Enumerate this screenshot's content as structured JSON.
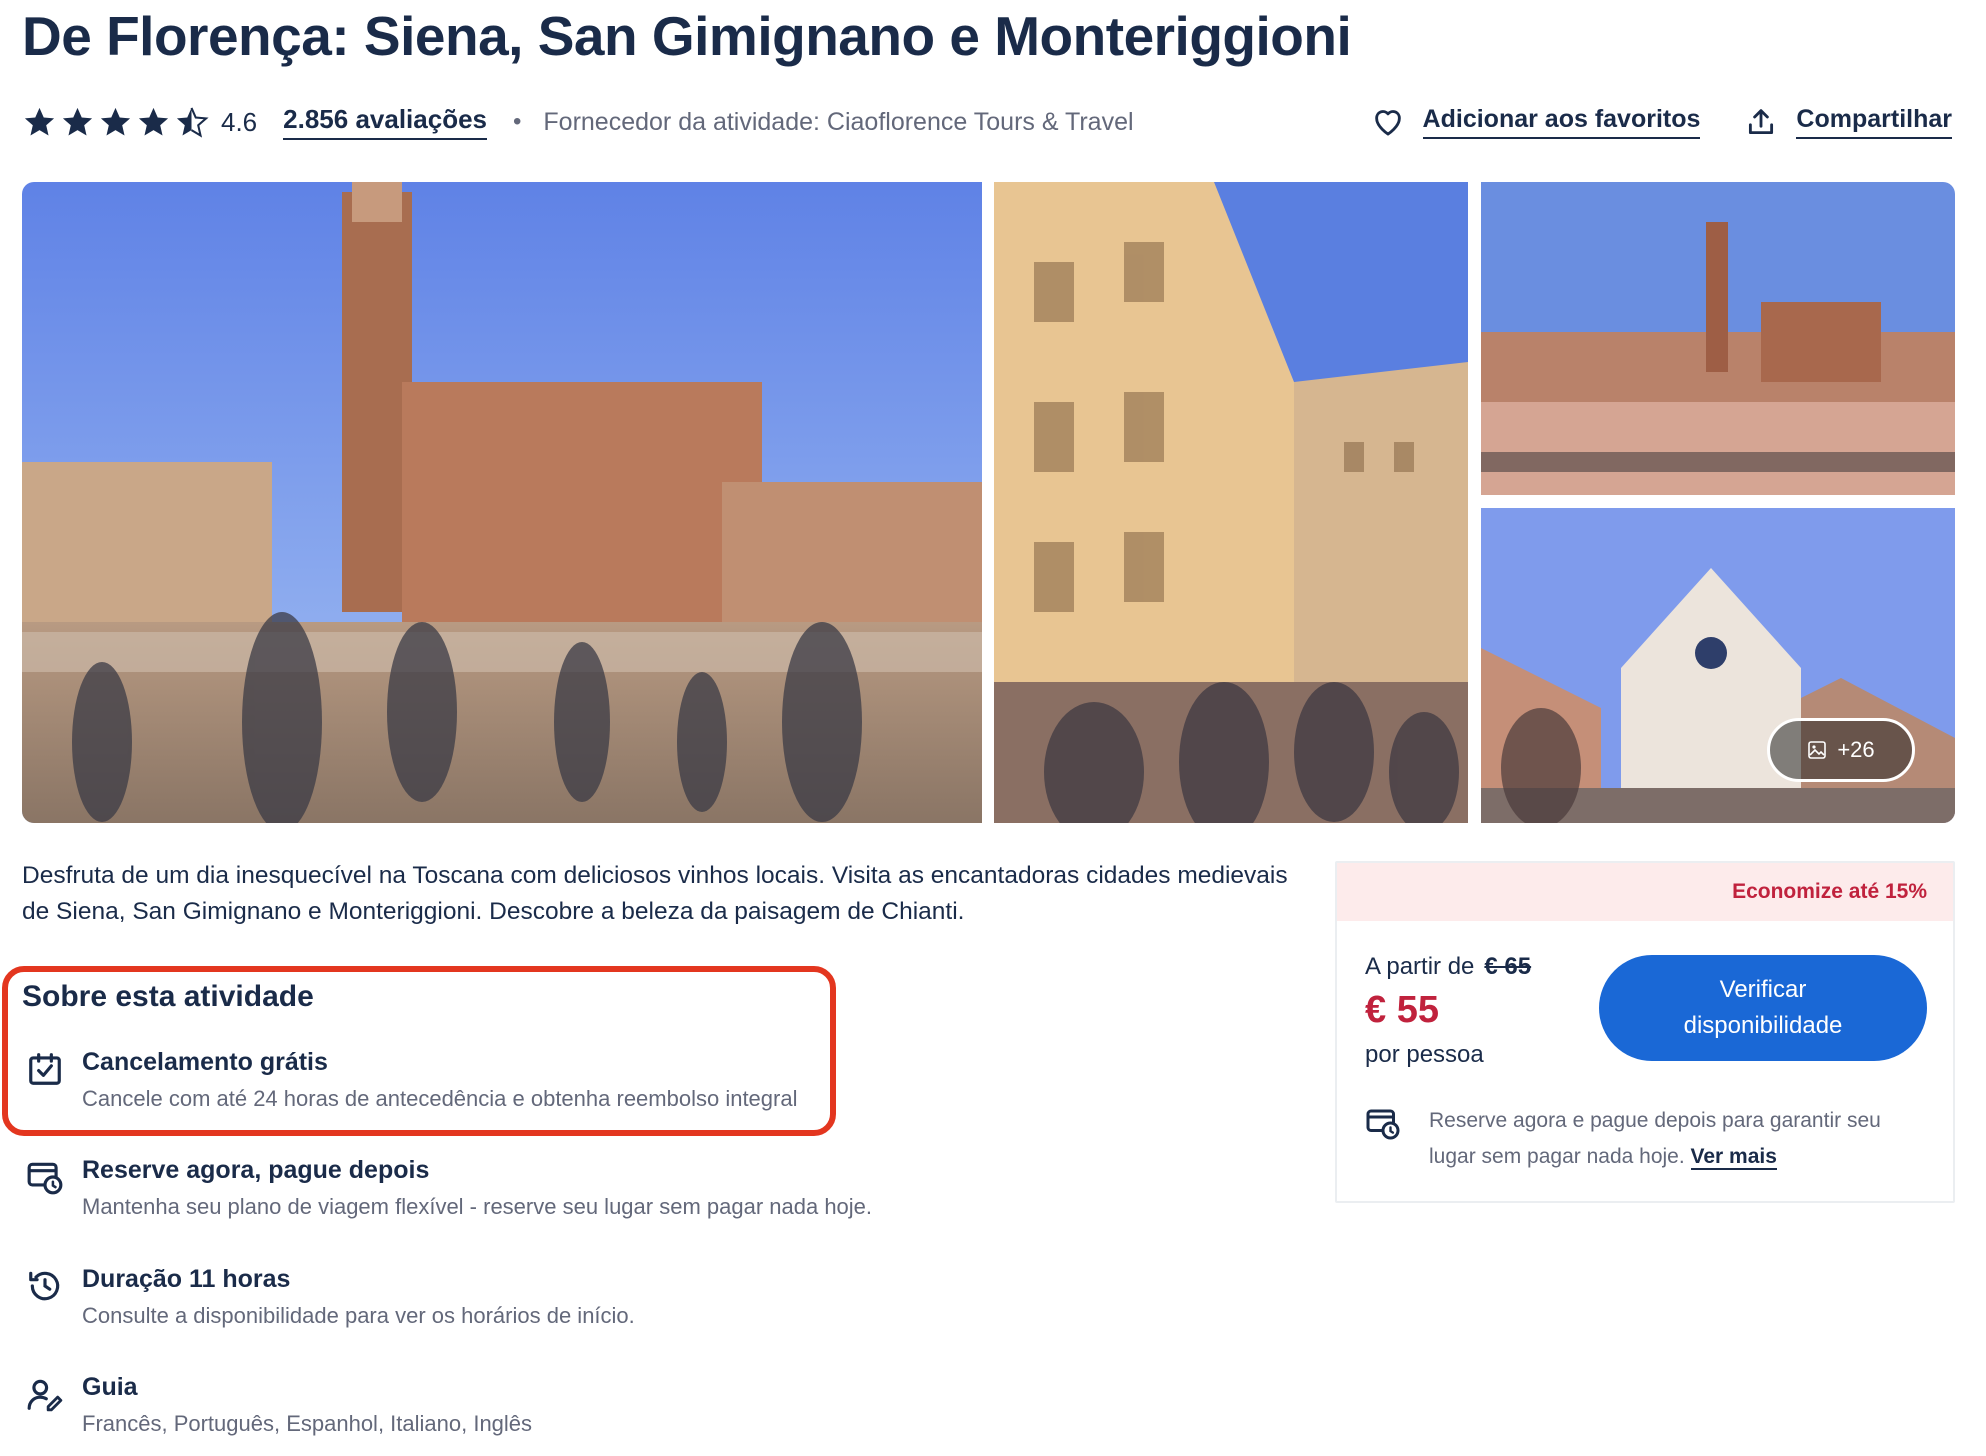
{
  "title": "De Florença: Siena, San Gimignano e Monteriggioni",
  "rating": {
    "value": "4.6",
    "stars_filled": 4.5,
    "stars_total": 5,
    "reviews_label": "2.856 avaliações",
    "separator": "•",
    "provider": "Fornecedor da atividade: Ciaoflorence Tours & Travel"
  },
  "actions": {
    "favorite_label": "Adicionar aos favoritos",
    "favorite_icon": "heart-icon",
    "share_label": "Compartilhar",
    "share_icon": "share-upload-icon"
  },
  "gallery": {
    "more_label": "+26",
    "more_icon": "image-icon"
  },
  "description": "Desfruta de um dia inesquecível na Toscana com deliciosos vinhos locais. Visita as encantadoras cidades medievais de Siena, San Gimignano e Monteriggioni. Descobre a beleza da paisagem de Chianti.",
  "about": {
    "title": "Sobre esta atividade",
    "highlight_color": "#e3361f",
    "features": [
      {
        "icon": "calendar-check-icon",
        "title": "Cancelamento grátis",
        "subtitle": "Cancele com até 24 horas de antecedência e obtenha reembolso integral"
      },
      {
        "icon": "card-clock-icon",
        "title": "Reserve agora, pague depois",
        "subtitle": "Mantenha seu plano de viagem flexível - reserve seu lugar sem pagar nada hoje."
      },
      {
        "icon": "history-clock-icon",
        "title": "Duração 11 horas",
        "subtitle": "Consulte a disponibilidade para ver os horários de início."
      },
      {
        "icon": "guide-person-icon",
        "title": "Guia",
        "subtitle": "Francês, Português, Espanhol, Italiano, Inglês"
      }
    ]
  },
  "booking": {
    "savings": "Economize até 15%",
    "price_from_label": "A partir de",
    "price_old": "€ 65",
    "price_new": "€ 55",
    "per_person": "por pessoa",
    "button_line1": "Verificar",
    "button_line2": "disponibilidade",
    "reserve_text": "Reserve agora e pague depois para garantir seu lugar sem pagar nada hoje.",
    "see_more": "Ver mais",
    "colors": {
      "price": "#c0223d",
      "button": "#1a68d6",
      "savings_bg": "#fdebeb"
    }
  }
}
